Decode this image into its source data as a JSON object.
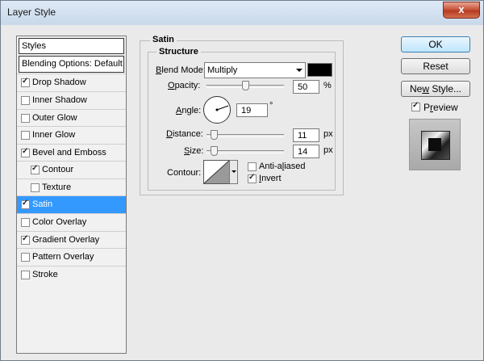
{
  "window": {
    "title": "Layer Style",
    "close_glyph": "x"
  },
  "sidebar": {
    "header": "Styles",
    "blending_options": "Blending Options: Default",
    "items": [
      {
        "label": "Drop Shadow",
        "checked": true,
        "selected": false
      },
      {
        "label": "Inner Shadow",
        "checked": false,
        "selected": false
      },
      {
        "label": "Outer Glow",
        "checked": false,
        "selected": false
      },
      {
        "label": "Inner Glow",
        "checked": false,
        "selected": false
      },
      {
        "label": "Bevel and Emboss",
        "checked": true,
        "selected": false
      },
      {
        "label": "Contour",
        "checked": true,
        "selected": false
      },
      {
        "label": "Texture",
        "checked": false,
        "selected": false
      },
      {
        "label": "Satin",
        "checked": true,
        "selected": true
      },
      {
        "label": "Color Overlay",
        "checked": false,
        "selected": false
      },
      {
        "label": "Gradient Overlay",
        "checked": true,
        "selected": false
      },
      {
        "label": "Pattern Overlay",
        "checked": false,
        "selected": false
      },
      {
        "label": "Stroke",
        "checked": false,
        "selected": false
      }
    ]
  },
  "satin": {
    "section_title": "Satin",
    "group_title": "Structure",
    "blend_mode": {
      "label_first": "B",
      "label_rest": "lend Mode:",
      "value": "Multiply",
      "color": "#000000"
    },
    "opacity": {
      "label_first": "O",
      "label_rest": "pacity:",
      "value": "50",
      "unit": "%"
    },
    "angle": {
      "label_first": "",
      "label_mid": "A",
      "label_rest": "ngle:",
      "value": "19",
      "unit": "°"
    },
    "distance": {
      "label_first": "D",
      "label_rest": "istance:",
      "value": "11",
      "unit": "px"
    },
    "size": {
      "label_first": "S",
      "label_rest": "ize:",
      "value": "14",
      "unit": "px"
    },
    "contour": {
      "label": "Contour:",
      "anti_aliased": {
        "label_pre": "Anti-a",
        "label_u": "l",
        "label_post": "iased",
        "checked": false
      },
      "invert": {
        "label_first": "I",
        "label_rest": "nvert",
        "checked": true
      }
    }
  },
  "buttons": {
    "ok": "OK",
    "reset": "Reset",
    "new_style_pre": "Ne",
    "new_style_u": "w",
    "new_style_post": " Style...",
    "preview_pre": "P",
    "preview_u": "r",
    "preview_post": "eview",
    "preview_checked": true
  }
}
